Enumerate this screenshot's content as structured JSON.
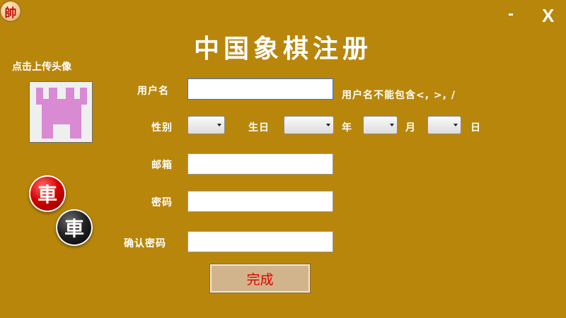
{
  "window": {
    "app_icon_glyph": "帥",
    "minimize": "-",
    "close": "X"
  },
  "title": "中国象棋注册",
  "avatar": {
    "caption": "点击上传头像",
    "placeholder_icon": "castle-rook-icon",
    "placeholder_color": "#d88ad2"
  },
  "pieces": {
    "red": "車",
    "black": "車"
  },
  "form": {
    "username_label": "用户名",
    "username_value": "",
    "username_hint": "用户名不能包含<, >, /",
    "gender_label": "性别",
    "birth_label": "生日",
    "year_label": "年",
    "month_label": "月",
    "day_label": "日",
    "email_label": "邮箱",
    "password_label": "密码",
    "confirm_label": "确认密码",
    "submit": "完成"
  },
  "colors": {
    "background": "#b8860b",
    "submit_bg": "#d2b48c",
    "submit_text": "#e00000"
  }
}
